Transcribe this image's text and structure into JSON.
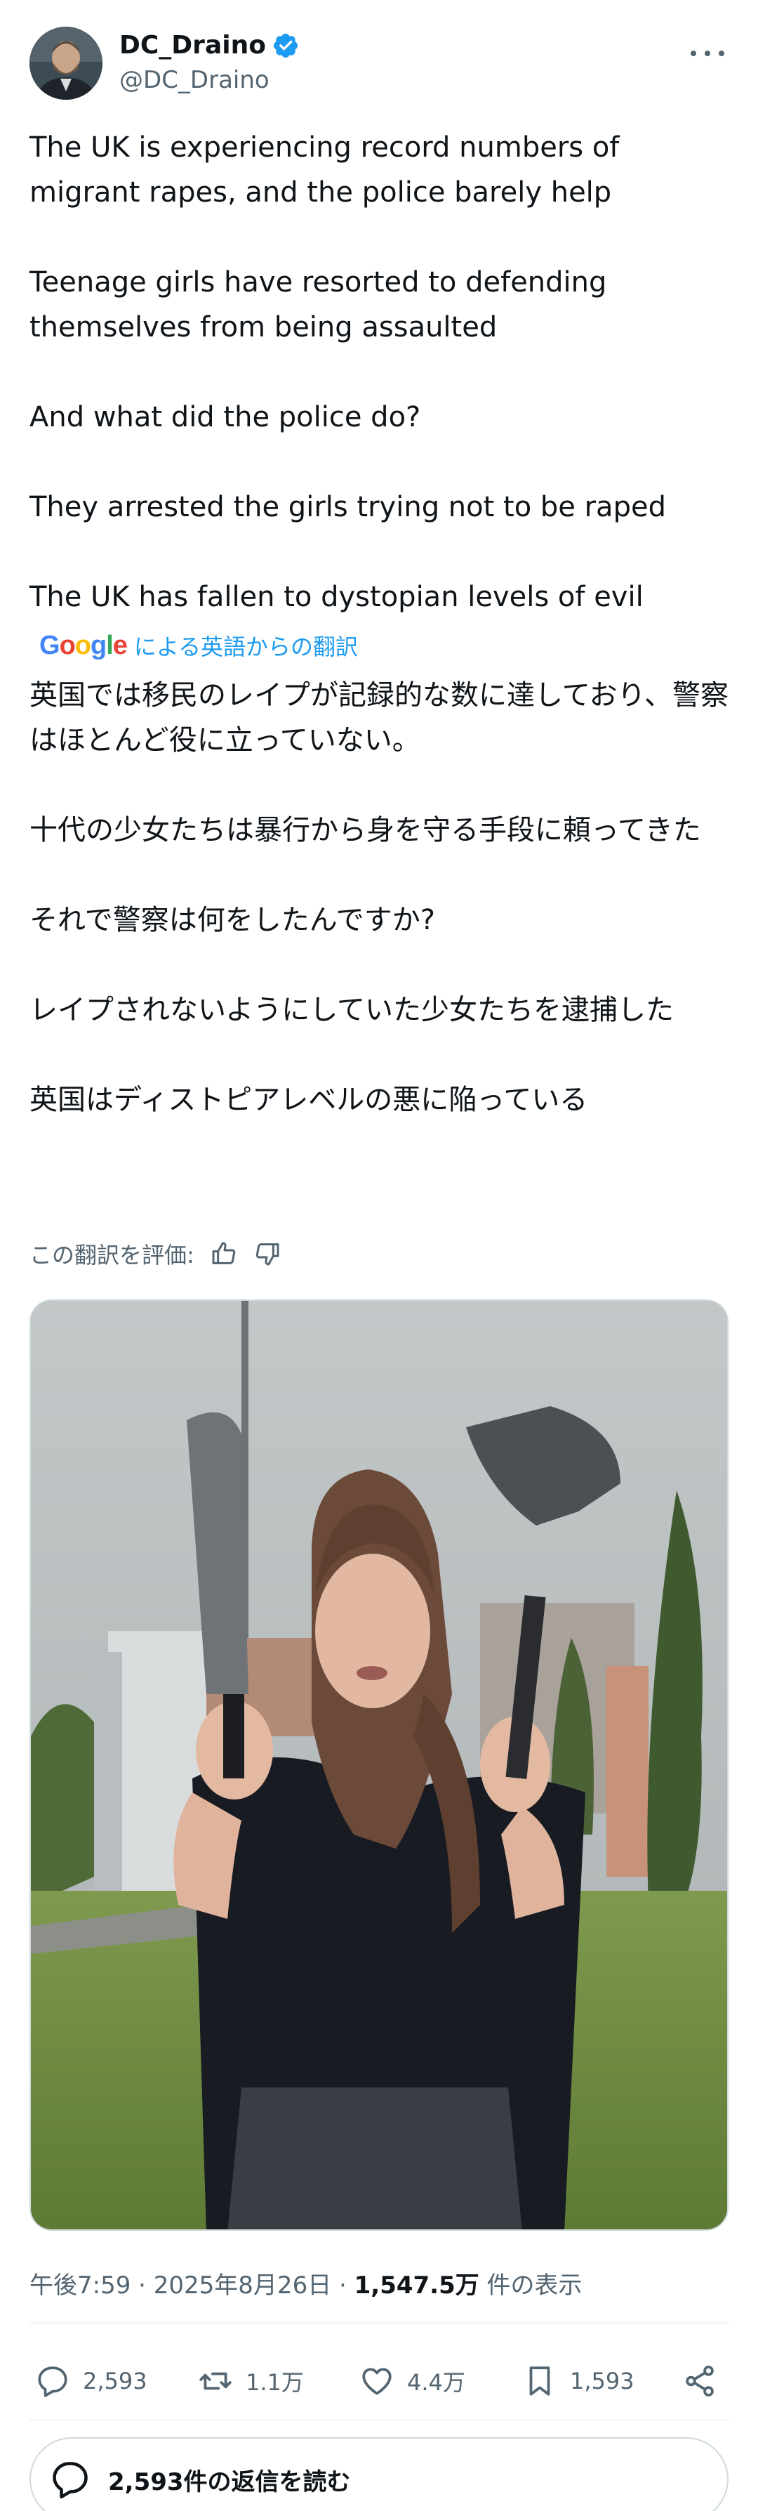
{
  "user": {
    "display_name": "DC_Draino",
    "handle": "@DC_Draino"
  },
  "tweet": {
    "paragraphs": [
      "The UK is experiencing record numbers of migrant rapes, and the police barely help",
      "Teenage girls have resorted to defending themselves from being assaulted",
      "And what did the police do?",
      "They arrested the girls trying not to be raped",
      "The UK has fallen to dystopian levels of evil"
    ]
  },
  "translation": {
    "provider": "Google",
    "label": "による英語からの翻訳",
    "paragraphs": [
      "英国では移民のレイプが記録的な数に達しており、警察はほとんど役に立っていない。",
      "十代の少女たちは暴行から身を守る手段に頼ってきた",
      "それで警察は何をしたんですか?",
      "レイプされないようにしていた少女たちを逮捕した",
      "英国はディストピアレベルの悪に陥っている"
    ],
    "rate_label": "この翻訳を評価:"
  },
  "meta": {
    "time": "午後7:59 · 2025年8月26日 · ",
    "views": "1,547.5万",
    "views_label": " 件の表示"
  },
  "actions": {
    "replies": "2,593",
    "reposts": "1.1万",
    "likes": "4.4万",
    "bookmarks": "1,593"
  },
  "read_replies": "2,593件の返信を読む",
  "colors": {
    "accent": "#1d9bf0",
    "text": "#0f1419",
    "secondary": "#536471",
    "border": "#cfd9de"
  },
  "icons": [
    "verified-badge-icon",
    "more-icon",
    "thumbs-up-icon",
    "thumbs-down-icon",
    "reply-icon",
    "repost-icon",
    "like-icon",
    "bookmark-icon",
    "share-icon",
    "chat-bubble-icon"
  ]
}
